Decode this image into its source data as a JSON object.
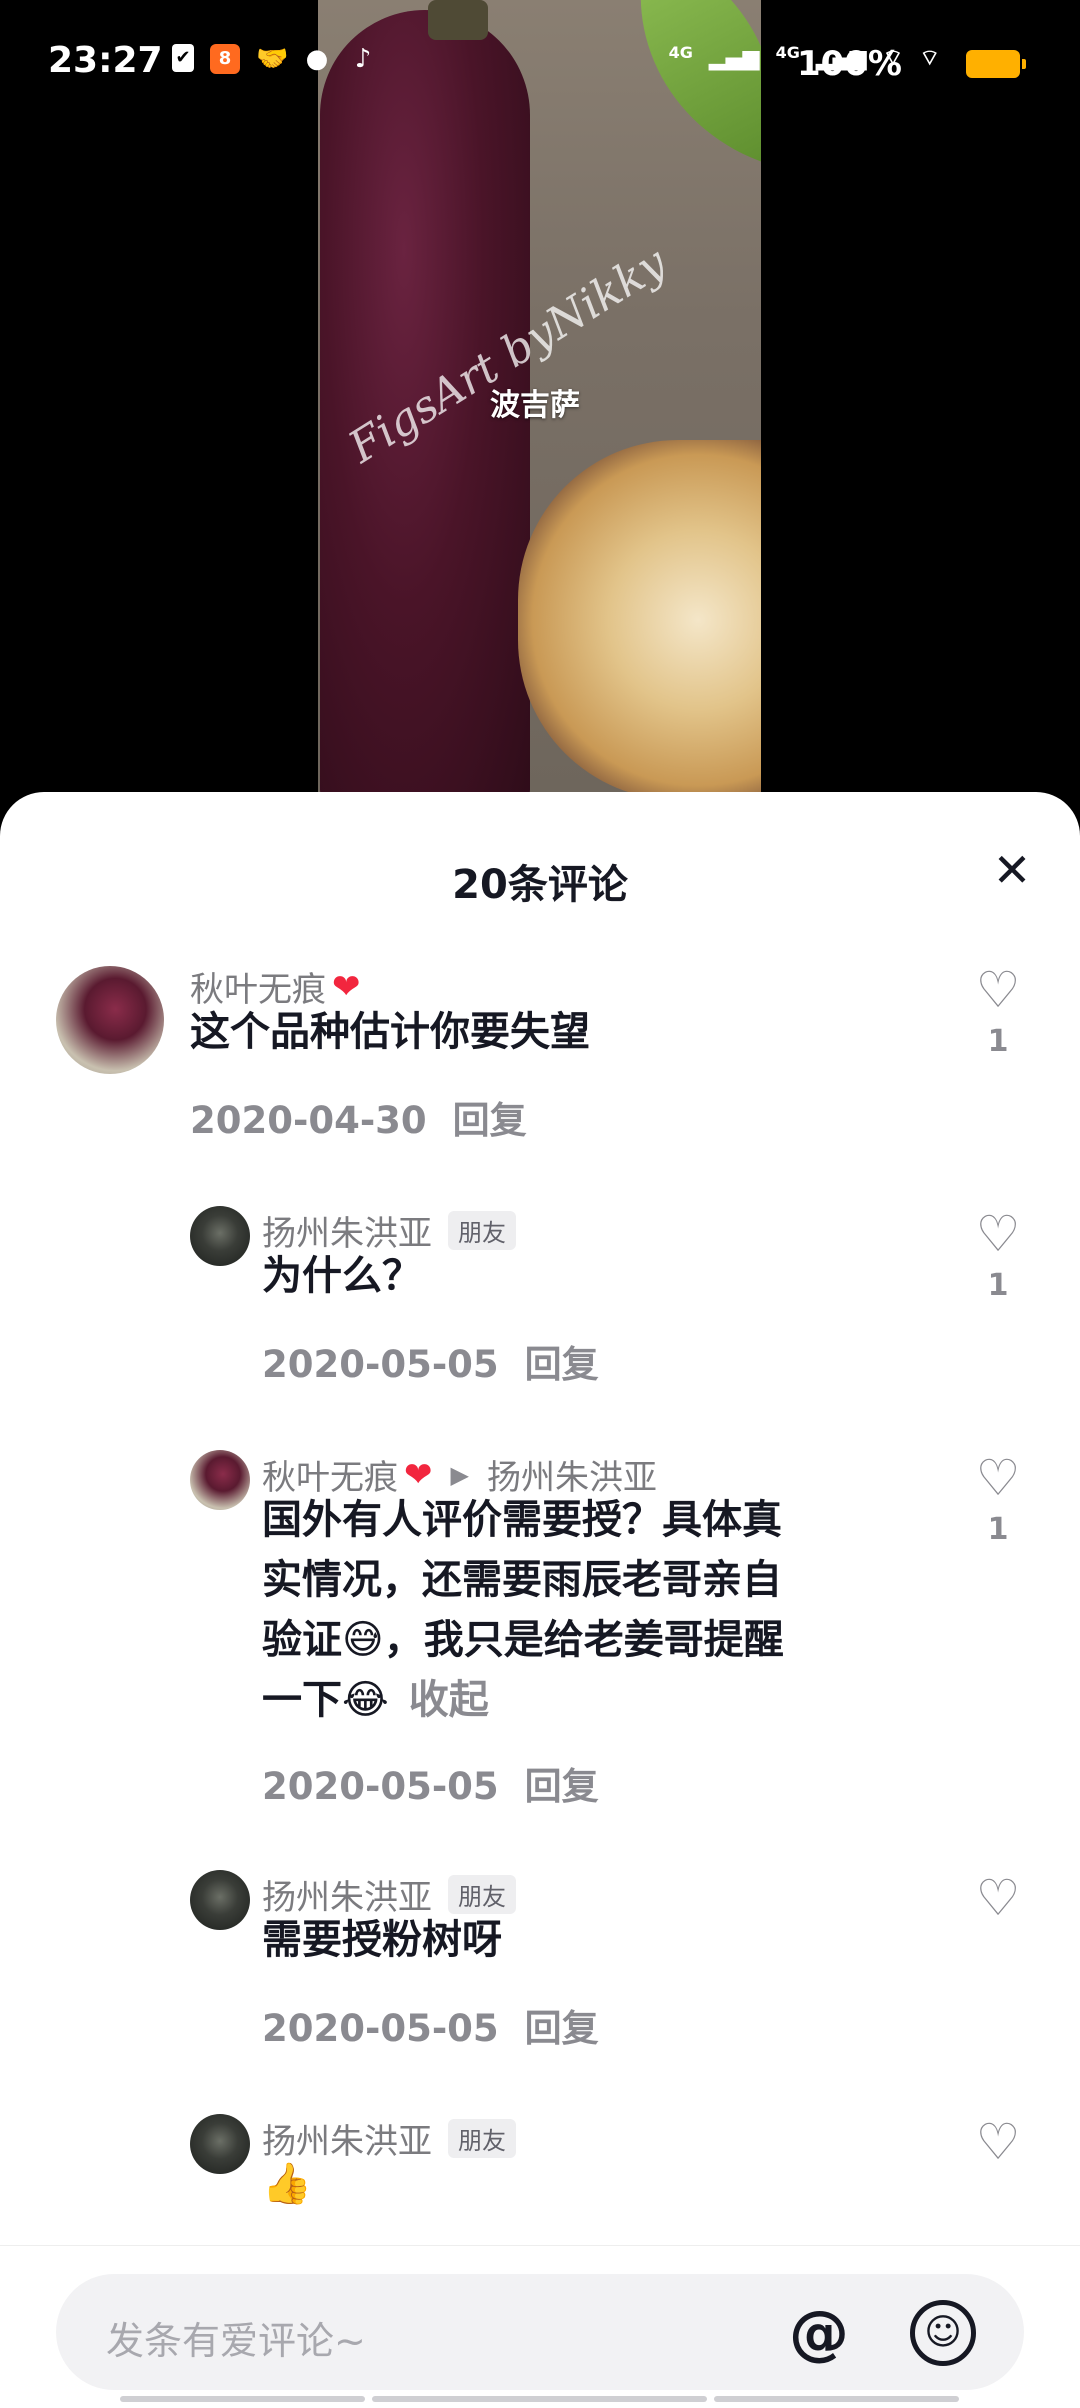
{
  "status_bar": {
    "time": "23:27",
    "net_1": "4G",
    "net_2": "4G",
    "battery": "100%"
  },
  "video": {
    "caption": "波吉萨",
    "watermark": "FigsArt byNikky"
  },
  "sheet": {
    "title": "20条评论",
    "close_icon": "✕"
  },
  "comments": [
    {
      "name": "秋叶无痕",
      "heart": "❤",
      "text": "这个品种估计你要失望",
      "date": "2020-04-30",
      "reply": "回复",
      "likes": "1"
    },
    {
      "name": "扬州朱洪亚",
      "tag": "朋友",
      "text": "为什么？",
      "date": "2020-05-05",
      "reply": "回复",
      "likes": "1"
    },
    {
      "name": "秋叶无痕",
      "heart": "❤",
      "reply_to": "扬州朱洪亚",
      "text_1": "国外有人评价需要授？具体真",
      "text_2": "实情况，还需要雨辰老哥亲自",
      "text_3": "验证😅，我只是给老姜哥提醒",
      "text_4": "一下😂",
      "collapse": "收起",
      "date": "2020-05-05",
      "reply": "回复",
      "likes": "1"
    },
    {
      "name": "扬州朱洪亚",
      "tag": "朋友",
      "text": "需要授粉树呀",
      "date": "2020-05-05",
      "reply": "回复"
    },
    {
      "name": "扬州朱洪亚",
      "tag": "朋友",
      "text": "👍"
    }
  ],
  "input": {
    "placeholder": "发条有爱评论~",
    "at_icon": "@",
    "emoji_icon": "☺"
  }
}
